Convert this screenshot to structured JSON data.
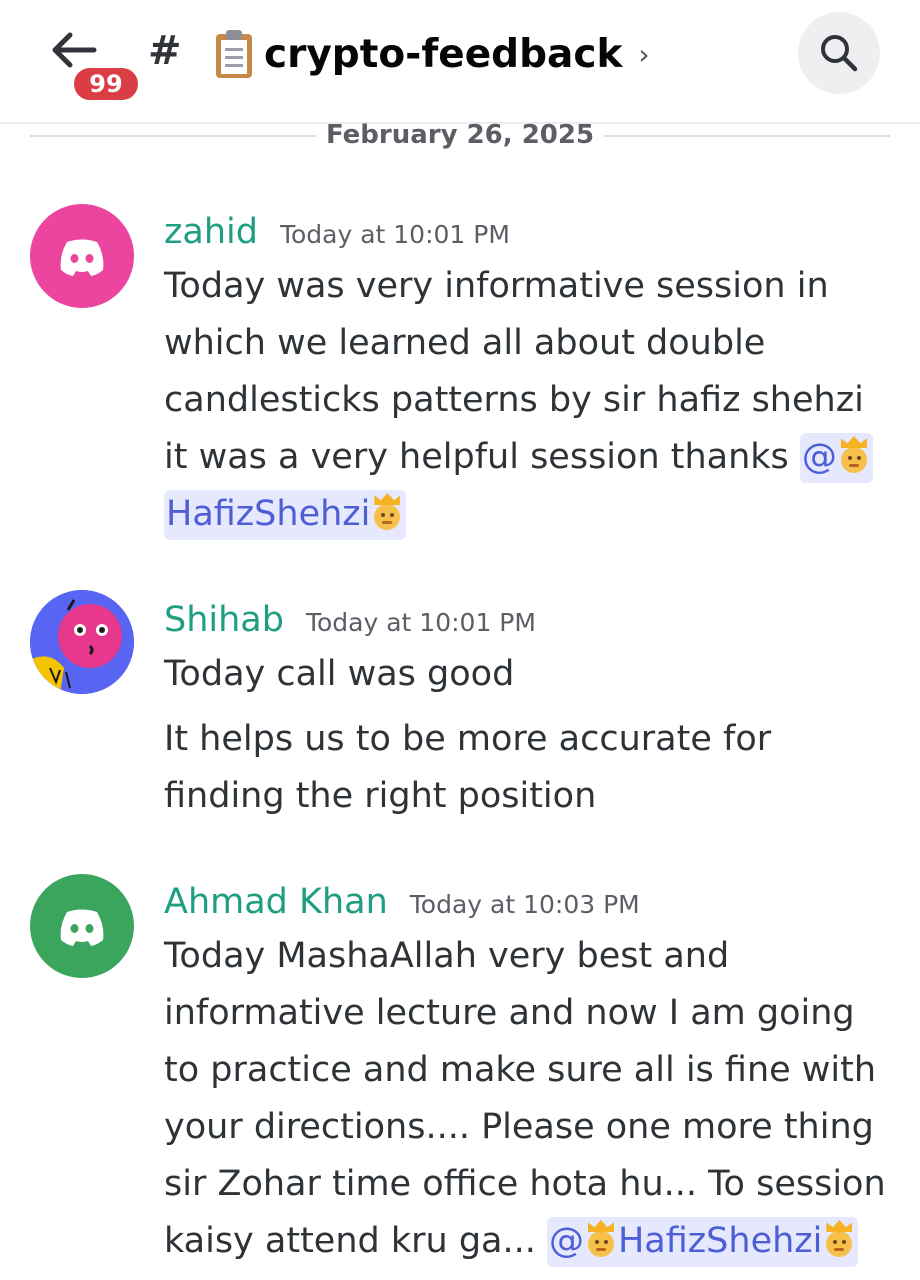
{
  "header": {
    "unread_count": "99",
    "channel_prefix": "#",
    "channel_name": "crypto-feedback",
    "channel_emoji": "clipboard-icon",
    "chevron": "›"
  },
  "divider": {
    "date": "February 26, 2025"
  },
  "messages": [
    {
      "author": "zahid",
      "time": "Today at 10:01 PM",
      "avatar": "discord-default-pink",
      "lines": [
        "Today was very informative session in",
        "which we learned all about double",
        "candlesticks patterns by sir hafiz shehzi",
        "it was a very helpful session thanks "
      ],
      "mention_at": "@",
      "mention_name": "HafizShehzi"
    },
    {
      "author": "Shihab",
      "time": "Today at 10:01 PM",
      "avatar": "custom-pink-character",
      "paragraphs": [
        "Today call was good",
        "It helps us to be more accurate for",
        "finding the right position"
      ]
    },
    {
      "author": "Ahmad Khan",
      "time": "Today at 10:03 PM",
      "avatar": "discord-default-green",
      "lines": [
        "Today MashaAllah very best and",
        "informative lecture and now I am going",
        "to practice and make sure all is fine with",
        "your directions.... Please one more thing",
        "sir Zohar time office hota hu... To session",
        "kaisy attend kru ga... "
      ],
      "mention_at": "@",
      "mention_name": "HafizShehzi"
    }
  ],
  "colors": {
    "author": "#1f9e82",
    "mention_bg": "#e6e8fd",
    "mention_text": "#4e5fd6",
    "badge": "#da3e44"
  }
}
